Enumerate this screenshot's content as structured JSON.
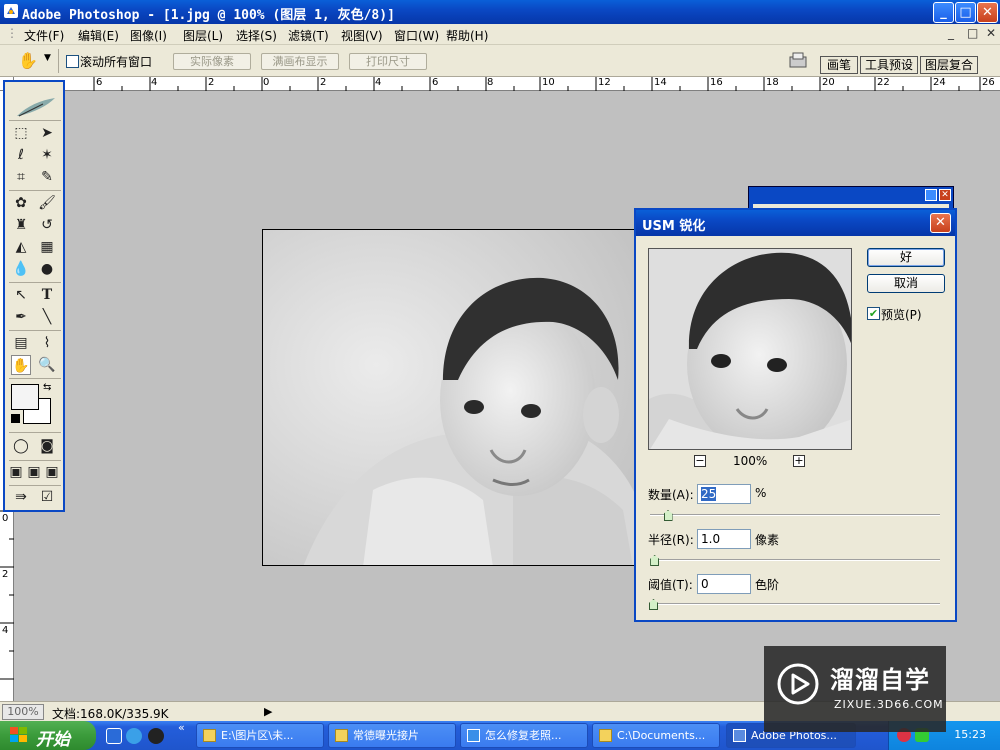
{
  "window": {
    "title": "Adobe Photoshop - [1.jpg @ 100% (图层 1, 灰色/8)]",
    "minimize": "_",
    "maximize": "□",
    "close": "✕"
  },
  "menu": {
    "items": [
      "文件(F)",
      "编辑(E)",
      "图像(I)",
      "图层(L)",
      "选择(S)",
      "滤镜(T)",
      "视图(V)",
      "窗口(W)",
      "帮助(H)"
    ],
    "doc_controls": [
      "_",
      "□",
      "✕"
    ]
  },
  "options": {
    "scroll_all_label": "滚动所有窗口",
    "scroll_all_checked": false,
    "buttons": [
      "实际像素",
      "满画布显示",
      "打印尺寸"
    ],
    "palette_tabs": [
      "画笔",
      "工具预设",
      "图层复合"
    ]
  },
  "rulers": {
    "horizontal": [
      "6",
      "4",
      "2",
      "0",
      "2",
      "4",
      "6",
      "8",
      "10",
      "12",
      "14",
      "16",
      "18",
      "20",
      "22",
      "24",
      "26"
    ],
    "vertical": [
      "0",
      "2",
      "4"
    ]
  },
  "dialog": {
    "title": "USM 锐化",
    "ok_label": "好",
    "cancel_label": "取消",
    "preview_label": "预览(P)",
    "preview_checked": true,
    "zoom_out": "−",
    "zoom_in": "+",
    "zoom": "100%",
    "amount": {
      "label": "数量(A):",
      "value": "25",
      "unit": "%",
      "slider_fraction": 0.05
    },
    "radius": {
      "label": "半径(R):",
      "value": "1.0",
      "unit": "像素",
      "slider_fraction": 0.004
    },
    "threshold": {
      "label": "阈值(T):",
      "value": "0",
      "unit": "色阶",
      "slider_fraction": 0.0
    }
  },
  "status": {
    "zoom": "100%",
    "doc": "文档:168.0K/335.9K",
    "arrow": "▶"
  },
  "taskbar": {
    "start": "开始",
    "items": [
      "E:\\图片区\\未...",
      "常德曝光接片",
      "怎么修复老照...",
      "C:\\Documents...",
      "Adobe Photos..."
    ],
    "active_index": 4,
    "clock": "15:23",
    "expand": "«"
  },
  "watermark": {
    "main": "溜溜自学",
    "sub": "ZIXUE.3D66.COM"
  },
  "colors": {
    "xp_blue": "#0a48c4",
    "face": "#ece9d8",
    "workspace": "#c0c0c0",
    "selection": "#316ac5"
  }
}
